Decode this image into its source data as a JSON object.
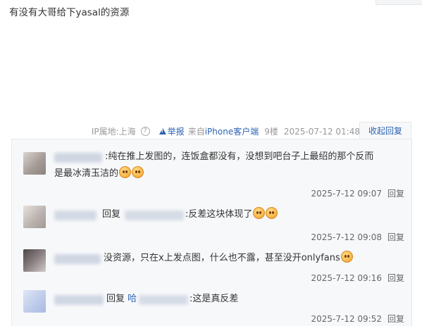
{
  "post": {
    "content": "有没有大哥给下yasal的资源"
  },
  "post_meta": {
    "ip_label": "IP属地:上海",
    "help_icon": "question-circle-icon",
    "report_label": "举报",
    "client_prefix": "来自",
    "client_name": "iPhone客户端",
    "floor": "9楼",
    "datetime": "2025-07-12 01:48",
    "collapse_label": "收起回复"
  },
  "replies": [
    {
      "avatar_color": "#b9b0ab",
      "text_before": ":纯在推上发图的，连饭盒都没有，没想到吧台子上最绍的那个反而",
      "text_line2": "是最冰清玉洁的",
      "emoji_count": 2,
      "time": "2025-7-12 09:07",
      "reply_label": "回复"
    },
    {
      "avatar_color": "#a9a3a0",
      "reply_word": "回复",
      "text_after": ":反差这块体现了",
      "emoji_count": 2,
      "time": "2025-7-12 09:08",
      "reply_label": "回复"
    },
    {
      "avatar_color": "#6f6668",
      "text_before": "没资源，只在x上发点图，什么也不露，甚至没开onlyfans",
      "emoji_count": 1,
      "time": "2025-7-12 09:16",
      "reply_label": "回复"
    },
    {
      "avatar_color": "#c9d3ea",
      "reply_word": "回复",
      "reply_target_prefix": "哈",
      "text_after": ":这是真反差",
      "emoji_count": 0,
      "time": "2025-7-12 09:52",
      "reply_label": "回复"
    }
  ]
}
